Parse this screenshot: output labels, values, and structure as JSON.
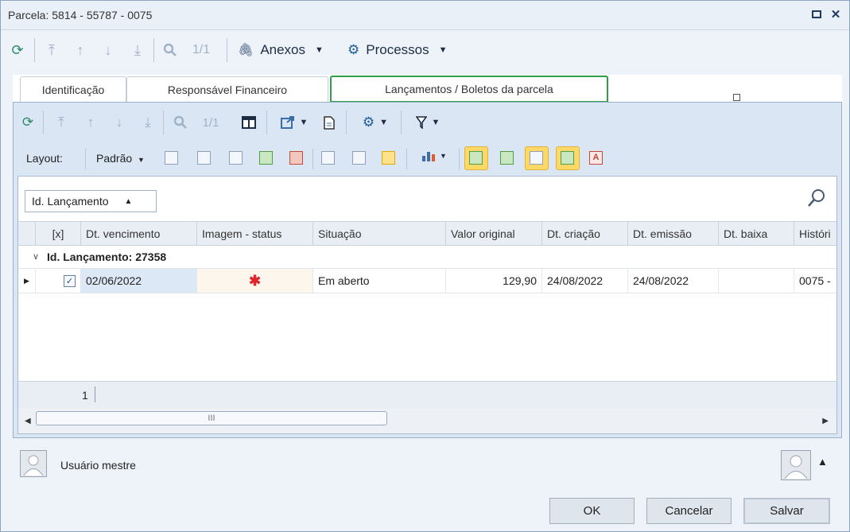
{
  "window": {
    "title": "Parcela: 5814 - 55787 - 0075"
  },
  "toolbar": {
    "page": "1/1",
    "anexos": "Anexos",
    "processos": "Processos"
  },
  "tabs": [
    {
      "label": "Identificação"
    },
    {
      "label": "Responsável Financeiro"
    },
    {
      "label": "Lançamentos / Boletos da parcela"
    }
  ],
  "inner_toolbar": {
    "page": "1/1"
  },
  "layout_bar": {
    "layout_label": "Layout:",
    "preset": "Padrão"
  },
  "grid": {
    "group_by": "Id. Lançamento",
    "columns": [
      "[x]",
      "Dt. vencimento",
      "Imagem - status",
      "Situação",
      "Valor original",
      "Dt. criação",
      "Dt. emissão",
      "Dt. baixa",
      "Históri"
    ],
    "group_row": "Id. Lançamento: 27358",
    "rows": [
      {
        "checked": true,
        "dt_vencimento": "02/06/2022",
        "imagem_status": "✱",
        "situacao": "Em aberto",
        "valor_original": "129,90",
        "dt_criacao": "24/08/2022",
        "dt_emissao": "24/08/2022",
        "dt_baixa": "",
        "historico": "0075 -"
      }
    ],
    "footer_count": "1",
    "scroll_grip": "III"
  },
  "user": {
    "name": "Usuário mestre"
  },
  "buttons": {
    "ok": "OK",
    "cancel": "Cancelar",
    "save": "Salvar"
  },
  "colors": {
    "active_tab_border": "#2e9e48",
    "status_star": "#e0262b"
  },
  "icons": [
    "refresh-icon",
    "first-icon",
    "up-icon",
    "down-icon",
    "last-icon",
    "search-icon",
    "paperclip-icon",
    "gear-icon",
    "filter-icon",
    "chart-icon"
  ]
}
